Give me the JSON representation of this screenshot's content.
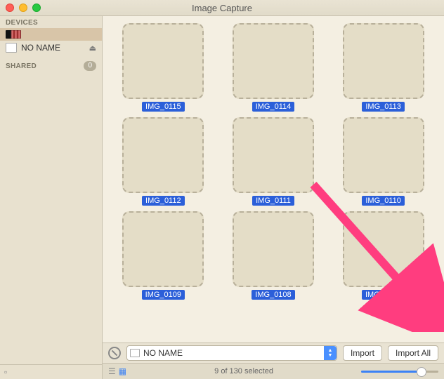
{
  "window": {
    "title": "Image Capture"
  },
  "sidebar": {
    "devices_header": "DEVICES",
    "shared_header": "SHARED",
    "shared_count": "0",
    "device_phone": "",
    "device_sd": "NO NAME"
  },
  "grid": {
    "items": [
      {
        "name": "IMG_0115"
      },
      {
        "name": "IMG_0114"
      },
      {
        "name": "IMG_0113"
      },
      {
        "name": "IMG_0112"
      },
      {
        "name": "IMG_0111"
      },
      {
        "name": "IMG_0110"
      },
      {
        "name": "IMG_0109"
      },
      {
        "name": "IMG_0108"
      },
      {
        "name": "IMG_0107"
      }
    ]
  },
  "toolbar": {
    "destination": "NO NAME",
    "import_label": "Import",
    "import_all_label": "Import All"
  },
  "status": {
    "text": "9 of 130 selected"
  }
}
